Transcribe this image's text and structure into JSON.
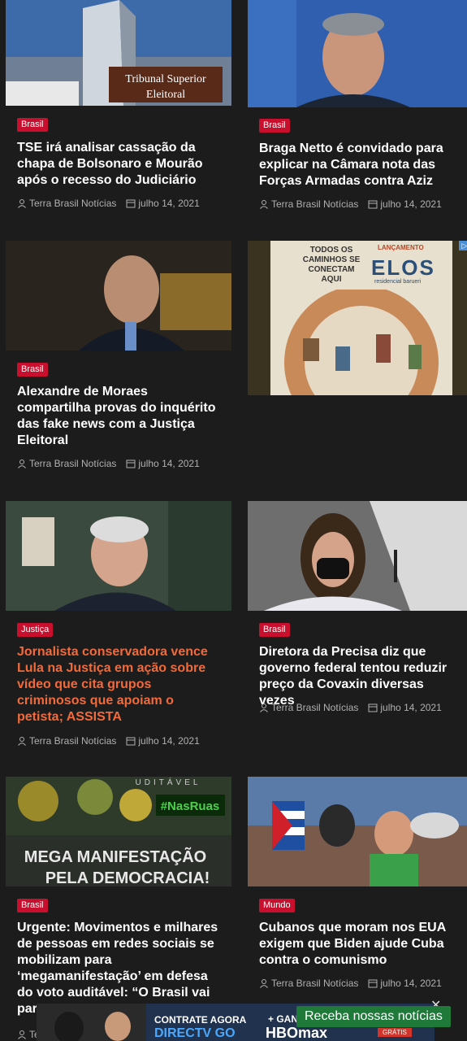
{
  "articles": [
    {
      "category": "Brasil",
      "title": "TSE irá analisar cassação da chapa de Bolsonaro e Mourão após o recesso do Judiciário",
      "author": "Terra Brasil Notícias",
      "date": "julho 14, 2021",
      "image_text": [
        "Tribunal Superior",
        "Eleitoral"
      ]
    },
    {
      "category": "Brasil",
      "title": "Braga Netto é convidado para explicar na Câmara nota das Forças Armadas contra Aziz",
      "author": "Terra Brasil Notícias",
      "date": "julho 14, 2021"
    },
    {
      "category": "Brasil",
      "title": "Alexandre de Moraes compartilha provas do inquérito das fake news com a Justiça Eleitoral",
      "author": "Terra Brasil Notícias",
      "date": "julho 14, 2021"
    },
    {
      "category": "Justiça",
      "title": "Jornalista conservadora vence Lula na Justiça em ação sobre vídeo que cita grupos criminosos que apoiam o petista; ASSISTA",
      "author": "Terra Brasil Notícias",
      "date": "julho 14, 2021"
    },
    {
      "category": "Brasil",
      "title": "Diretora da Precisa diz que governo federal tentou reduzir preço da Covaxin diversas vezes",
      "author": "Terra Brasil Notícias",
      "date": "julho 14, 2021"
    },
    {
      "category": "Brasil",
      "title": "Urgente: Movimentos e milhares de pessoas em redes sociais se mobilizam para ‘megamanifestação’ em defesa do voto auditável: “O Brasil vai para”",
      "author": "Te",
      "date": "",
      "image_text": [
        "UDITÁVEL",
        "#NasRuas",
        "MEGA MANIFESTAÇÃO",
        "PELA DEMOCRACIA!"
      ]
    },
    {
      "category": "Mundo",
      "title": "Cubanos que moram nos EUA exigem que Biden ajude Cuba contra o comunismo",
      "author": "Terra Brasil Notícias",
      "date": "julho 14, 2021"
    }
  ],
  "ad": {
    "line1": "TODOS OS",
    "line2": "CAMINHOS SE",
    "line3": "CONECTAM",
    "line4": "AQUI",
    "tag": "LANÇAMENTO",
    "brand": "ELOS",
    "sub": "residencial barueri"
  },
  "bottom_ad": {
    "text1": "CONTRATE AGORA",
    "text2": "DIRECTV GO",
    "text3": "+ GANHE",
    "text4": "HBOmax",
    "text5": "GRÁTIS"
  },
  "notify_label": "Receba nossas notícias",
  "close_label": "✕",
  "colors": {
    "category_bg": "#c8102e",
    "highlight_title": "#f26a3a",
    "background": "#1c1c1c"
  }
}
